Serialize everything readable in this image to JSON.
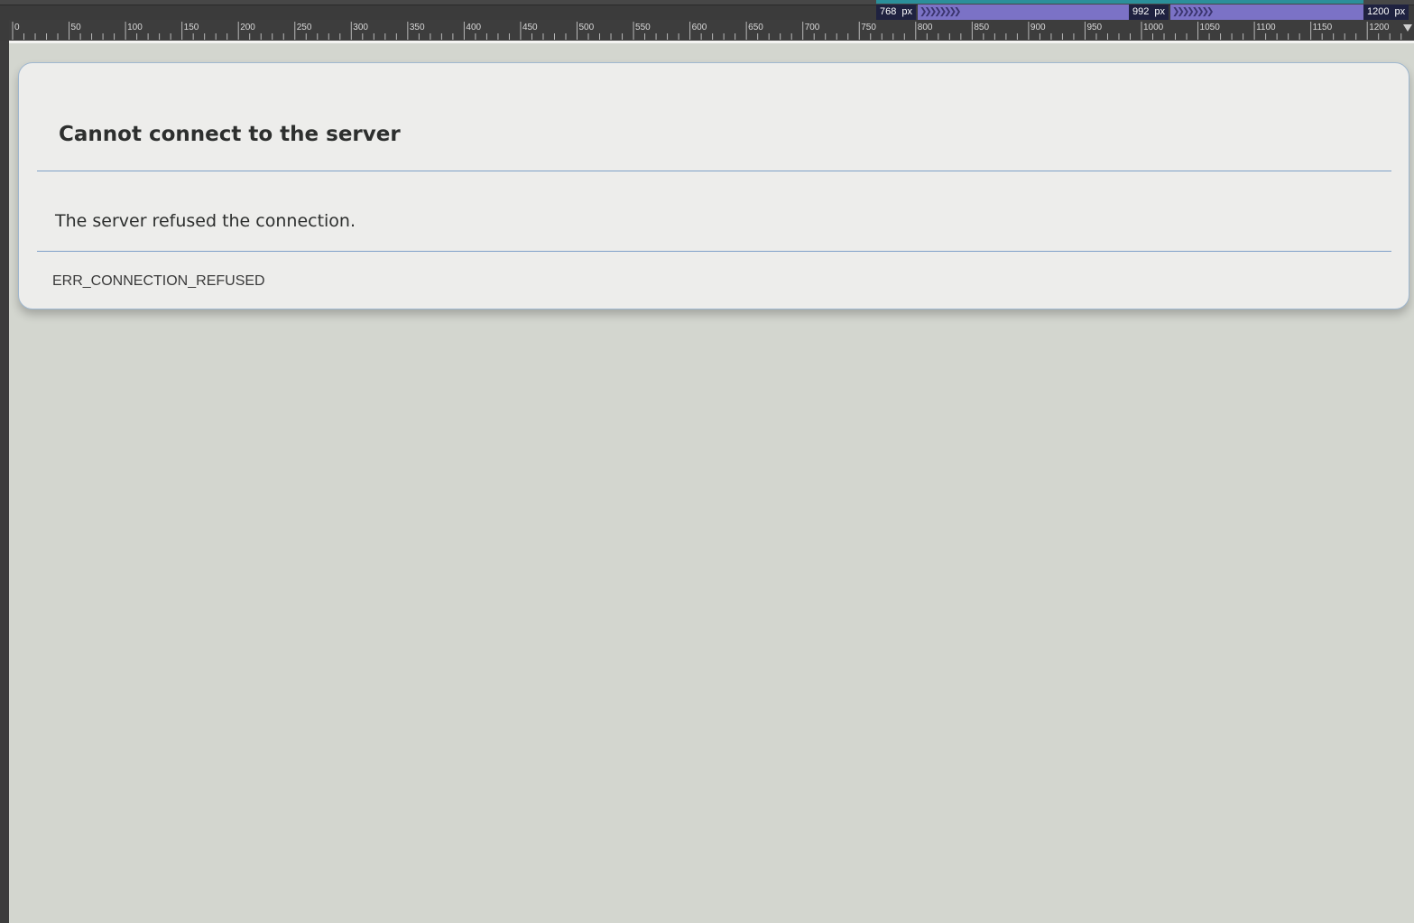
{
  "breakpoints": [
    {
      "value": "768",
      "unit": "px"
    },
    {
      "value": "992",
      "unit": "px"
    },
    {
      "value": "1200",
      "unit": "px"
    }
  ],
  "ruler": {
    "labels": [
      "0",
      "50",
      "100",
      "150",
      "200",
      "250",
      "300",
      "350",
      "400",
      "450",
      "500",
      "550",
      "600",
      "650",
      "700",
      "750",
      "800",
      "850",
      "900",
      "950",
      "1000",
      "1050",
      "1100",
      "1150",
      "1200"
    ]
  },
  "error": {
    "title": "Cannot connect to the server",
    "message": "The server refused the connection.",
    "code": "ERR_CONNECTION_REFUSED"
  },
  "colors": {
    "page_background": "#d3d6cf",
    "card_background": "#ededeb",
    "divider": "#7ea0c8",
    "breakpoint_bar": "#7b72c6",
    "breakpoint_label": "#1f2240"
  }
}
